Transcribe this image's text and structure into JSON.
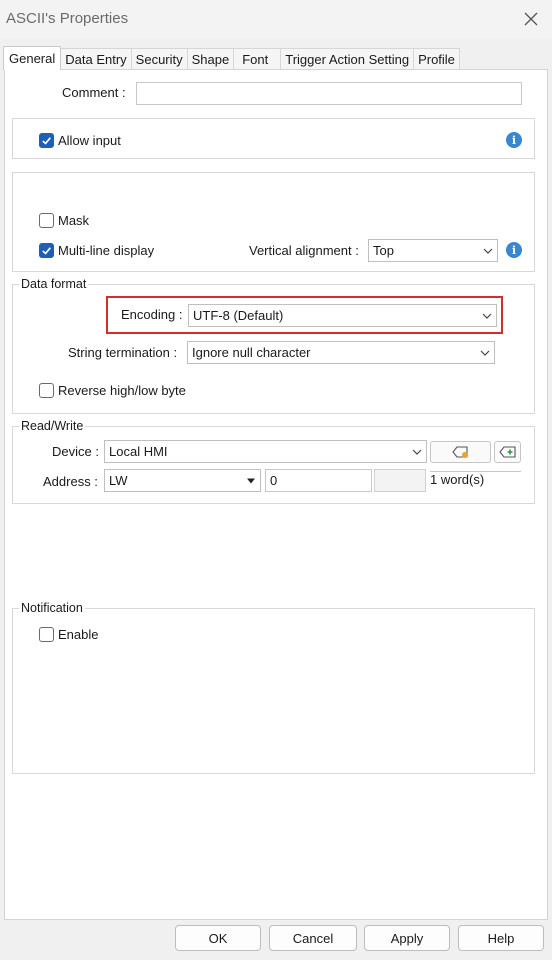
{
  "window": {
    "title": "ASCII's Properties"
  },
  "tabs": [
    "General",
    "Data Entry",
    "Security",
    "Shape",
    "Font",
    "Trigger Action Setting",
    "Profile"
  ],
  "comment": {
    "label": "Comment :",
    "value": ""
  },
  "allow_input": {
    "label": "Allow input",
    "checked": true
  },
  "mask": {
    "label": "Mask",
    "checked": false
  },
  "multiline": {
    "label": "Multi-line display",
    "checked": true
  },
  "vertical_alignment": {
    "label": "Vertical alignment :",
    "value": "Top"
  },
  "data_format": {
    "title": "Data format",
    "encoding_label": "Encoding :",
    "encoding_value": "UTF-8 (Default)",
    "string_term_label": "String termination :",
    "string_term_value": "Ignore null character",
    "reverse_label": "Reverse high/low byte",
    "reverse_checked": false
  },
  "read_write": {
    "title": "Read/Write",
    "device_label": "Device :",
    "device_value": "Local HMI",
    "address_label": "Address :",
    "address_type": "LW",
    "address_value": "0",
    "address_sub": "",
    "word_count": "1 word(s)"
  },
  "notification": {
    "title": "Notification",
    "enable_label": "Enable",
    "enable_checked": false
  },
  "buttons": {
    "ok": "OK",
    "cancel": "Cancel",
    "apply": "Apply",
    "help": "Help"
  },
  "colors": {
    "accent": "#1d5fb8",
    "info": "#3a86d1",
    "highlight": "#d32e2e"
  }
}
